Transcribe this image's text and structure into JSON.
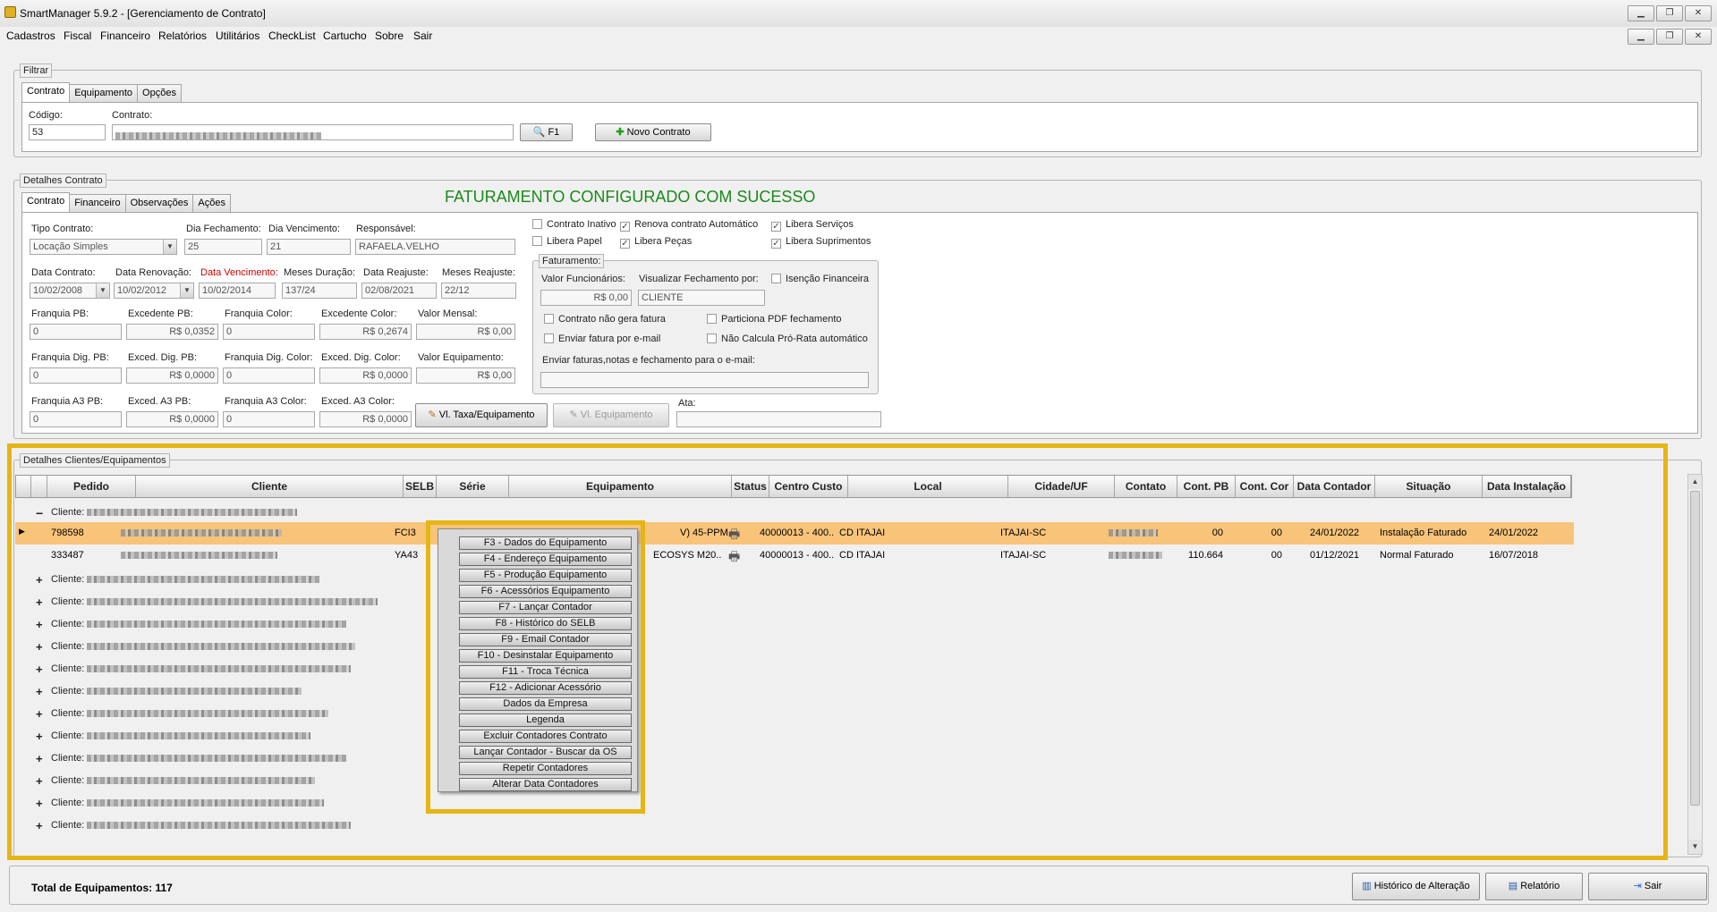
{
  "window": {
    "title": "SmartManager 5.9.2 - [Gerenciamento de Contrato]"
  },
  "menu": [
    "Cadastros",
    "Fiscal",
    "Financeiro",
    "Relatórios",
    "Utilitários",
    "CheckList",
    "Cartucho",
    "Sobre",
    "Sair"
  ],
  "filter": {
    "legend": "Filtrar",
    "tabs": [
      "Contrato",
      "Equipamento",
      "Opções"
    ],
    "codigo_label": "Código:",
    "codigo_value": "53",
    "contrato_label": "Contrato:",
    "f1_label": "F1",
    "novo_label": "Novo Contrato"
  },
  "details": {
    "legend": "Detalhes Contrato",
    "tabs": [
      "Contrato",
      "Financeiro",
      "Observações",
      "Ações"
    ],
    "success_message": "FATURAMENTO CONFIGURADO COM SUCESSO",
    "labels": {
      "tipo": "Tipo Contrato:",
      "dia_fech": "Dia Fechamento:",
      "dia_venc": "Dia Vencimento:",
      "resp": "Responsável:",
      "data_contrato": "Data Contrato:",
      "data_renov": "Data Renovação:",
      "data_venc": "Data Vencimento:",
      "meses_dur": "Meses Duração:",
      "data_reaj": "Data Reajuste:",
      "meses_reaj": "Meses Reajuste:",
      "franq_pb": "Franquia PB:",
      "exc_pb": "Excedente PB:",
      "franq_color": "Franquia Color:",
      "exc_color": "Excedente Color:",
      "valor_mensal": "Valor Mensal:",
      "franq_dig_pb": "Franquia Dig. PB:",
      "exc_dig_pb": "Exced. Dig. PB:",
      "franq_dig_color": "Franquia Dig. Color:",
      "exc_dig_color": "Exced. Dig. Color:",
      "valor_equip": "Valor Equipamento:",
      "franq_a3_pb": "Franquia A3 PB:",
      "exc_a3_pb": "Exced. A3 PB:",
      "franq_a3_color": "Franquia A3 Color:",
      "exc_a3_color": "Exced. A3 Color:",
      "ata": "Ata:"
    },
    "values": {
      "tipo": "Locação Simples",
      "dia_fech": "25",
      "dia_venc": "21",
      "resp": "RAFAELA.VELHO",
      "data_contrato": "10/02/2008",
      "data_renov": "10/02/2012",
      "data_venc": "10/02/2014",
      "meses_dur": "137/24",
      "data_reaj": "02/08/2021",
      "meses_reaj": "22/12",
      "franq_pb": "0",
      "exc_pb": "R$ 0,0352",
      "franq_color": "0",
      "exc_color": "R$ 0,2674",
      "valor_mensal": "R$ 0,00",
      "franq_dig_pb": "0",
      "exc_dig_pb": "R$ 0,0000",
      "franq_dig_color": "0",
      "exc_dig_color": "R$ 0,0000",
      "valor_equip": "R$ 0,00",
      "franq_a3_pb": "0",
      "exc_a3_pb": "R$ 0,0000",
      "franq_a3_color": "0",
      "exc_a3_color": "R$ 0,0000"
    },
    "btn_taxa": "Vl. Taxa/Equipamento",
    "btn_equip": "Vl. Equipamento",
    "checks": {
      "inativo": "Contrato Inativo",
      "renova": "Renova contrato Automático",
      "lib_serv": "Libera Serviços",
      "lib_papel": "Libera Papel",
      "lib_pecas": "Libera Peças",
      "lib_supr": "Libera Suprimentos"
    },
    "fat": {
      "legend": "Faturamento:",
      "valor_func_label": "Valor Funcionários:",
      "valor_func": "R$ 0,00",
      "visualizar_label": "Visualizar Fechamento por:",
      "visualizar": "CLIENTE",
      "isencao": "Isenção Financeira",
      "nao_gera": "Contrato não gera fatura",
      "particiona": "Particiona PDF fechamento",
      "enviar_email": "Enviar fatura por e-mail",
      "nao_calcula": "Não Calcula Pró-Rata automático",
      "email_label": "Enviar faturas,notas e fechamento para o e-mail:"
    }
  },
  "grid": {
    "legend": "Detalhes Clientes/Equipamentos",
    "columns": [
      "Pedido",
      "Cliente",
      "SELB",
      "Série",
      "Equipamento",
      "Status",
      "Centro Custo",
      "Local",
      "Cidade/UF",
      "Contato",
      "Cont. PB",
      "Cont. Cor",
      "Data Contador",
      "Situação",
      "Data Instalação"
    ],
    "client_prefix": "Cliente:",
    "rows": [
      {
        "pedido": "798598",
        "selb": "FCI3",
        "equip": "V) 45-PPM",
        "centro": "40000013 - 400..",
        "local": "CD ITAJAI",
        "cidade": "ITAJAI-SC",
        "pb": "00",
        "cor": "00",
        "data": "24/01/2022",
        "situacao": "Instalação Faturado",
        "inst": "24/01/2022"
      },
      {
        "pedido": "333487",
        "selb": "YA43",
        "equip": "ECOSYS M20..",
        "centro": "40000013 - 400..",
        "local": "CD ITAJAI",
        "cidade": "ITAJAI-SC",
        "pb": "110.664",
        "cor": "00",
        "data": "01/12/2021",
        "situacao": "Normal Faturado",
        "inst": "16/07/2018"
      }
    ]
  },
  "context_menu": [
    "F3 - Dados do Equipamento",
    "F4 - Endereço Equipamento",
    "F5 - Produção Equipamento",
    "F6 - Acessórios Equipamento",
    "F7 - Lançar Contador",
    "F8 - Histórico do SELB",
    "F9 - Email Contador",
    "F10 - Desinstalar Equipamento",
    "F11 - Troca Técnica",
    "F12 - Adicionar Acessório",
    "Dados da Empresa",
    "Legenda",
    "Excluir Contadores Contrato",
    "Lançar Contador - Buscar da OS",
    "Repetir Contadores",
    "Alterar Data Contadores"
  ],
  "footer": {
    "total_label": "Total de Equipamentos: 117",
    "historico": "Histórico de Alteração",
    "relatorio": "Relatório",
    "sair": "Sair"
  },
  "colors": {
    "success": "#1a8a1a",
    "highlight": "#e6b514",
    "selected_row": "#f7c47a",
    "red_label": "#cc0000"
  }
}
